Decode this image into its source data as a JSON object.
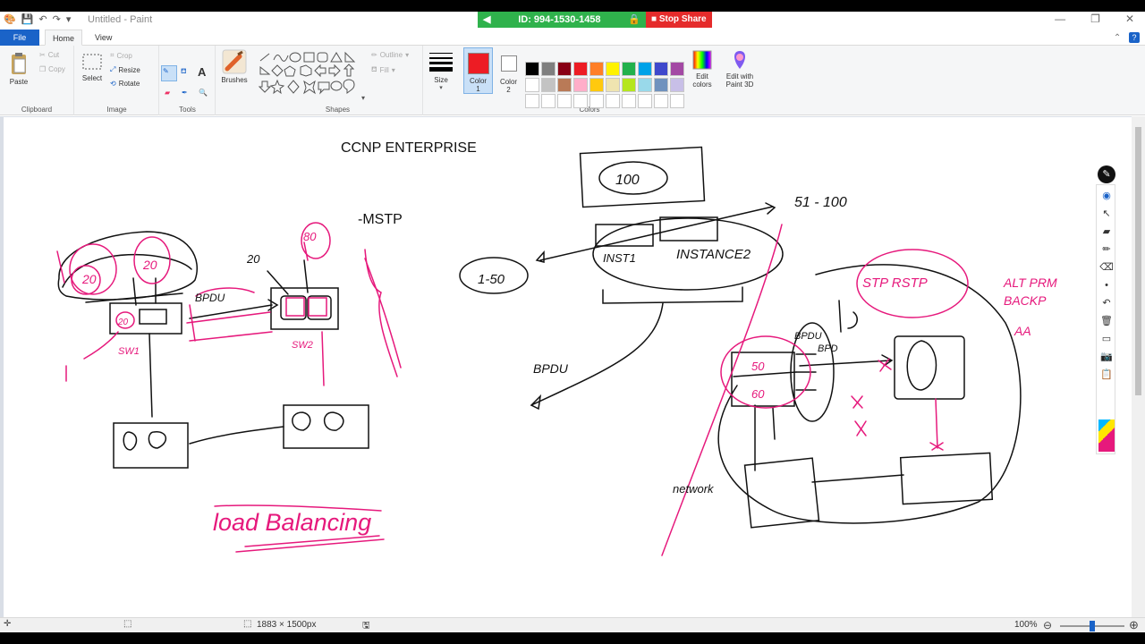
{
  "window": {
    "title": "Untitled - Paint",
    "controls": {
      "minimize": "—",
      "maximize": "❐",
      "close": "✕"
    }
  },
  "remote_session": {
    "id_text": "ID: 994-1530-1458",
    "stop_label": "Stop Share",
    "id_color": "#2fb24c",
    "stop_color": "#e52b2b"
  },
  "tabs": {
    "file": "File",
    "home": "Home",
    "view": "View"
  },
  "ribbon": {
    "clipboard": {
      "label": "Clipboard",
      "paste": "Paste",
      "cut": "Cut",
      "copy": "Copy"
    },
    "image": {
      "label": "Image",
      "select": "Select",
      "crop": "Crop",
      "resize": "Resize",
      "rotate": "Rotate"
    },
    "tools": {
      "label": "Tools"
    },
    "brushes": "Brushes",
    "shapes": {
      "label": "Shapes",
      "outline": "Outline",
      "fill": "Fill"
    },
    "size": "Size",
    "colors": {
      "label": "Colors",
      "color1_line1": "Color",
      "color1_line2": "1",
      "color2_line1": "Color",
      "color2_line2": "2",
      "color1_value": "#ed1c24",
      "color2_value": "#ffffff",
      "edit_line1": "Edit",
      "edit_line2": "colors",
      "paint3d_line1": "Edit with",
      "paint3d_line2": "Paint 3D",
      "palette": [
        "#000000",
        "#7f7f7f",
        "#880015",
        "#ed1c24",
        "#ff7f27",
        "#fff200",
        "#22b14c",
        "#00a2e8",
        "#3f48cc",
        "#a349a4",
        "#ffffff",
        "#c3c3c3",
        "#b97a57",
        "#ffaec9",
        "#ffc90e",
        "#efe4b0",
        "#b5e61d",
        "#99d9ea",
        "#7092be",
        "#c8bfe7",
        "#ffffff",
        "#ffffff",
        "#ffffff",
        "#ffffff",
        "#ffffff",
        "#ffffff",
        "#ffffff",
        "#ffffff",
        "#ffffff",
        "#ffffff"
      ]
    }
  },
  "canvas": {
    "heading": "CCNP ENTERPRISE",
    "mstp": "-MSTP"
  },
  "status": {
    "dimensions": "1883 × 1500px",
    "zoom": "100%",
    "zoom_fraction": 0.5
  }
}
